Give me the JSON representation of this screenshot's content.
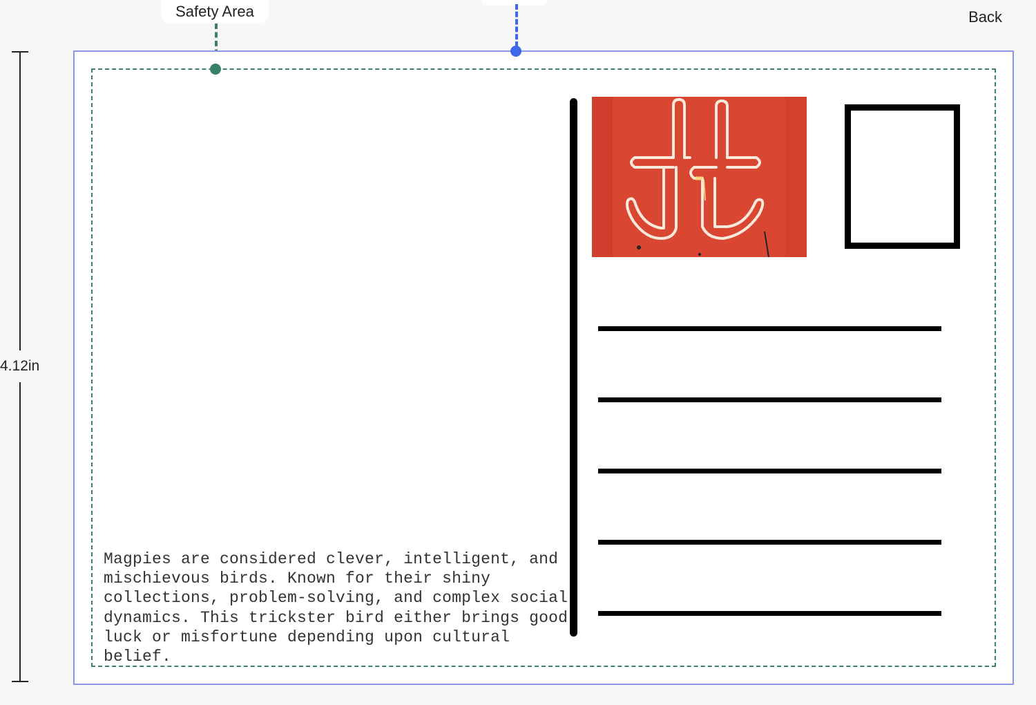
{
  "editor": {
    "side_label": "Back",
    "safety_area_label": "Safety Area",
    "height_label": "4.12in"
  },
  "postcard": {
    "message": "Magpies are considered clever, intelligent, and mischievous birds. Known for their shiny collections, problem-solving, and complex social dynamics. This trickster bird either brings good luck or misfortune depending upon cultural belief.",
    "photo_subject": "neon sign on red wall",
    "address_lines": 5
  },
  "colors": {
    "safety_guide": "#3a7f67",
    "bleed_guide": "#3f67e8",
    "photo_background": "#d94632"
  }
}
